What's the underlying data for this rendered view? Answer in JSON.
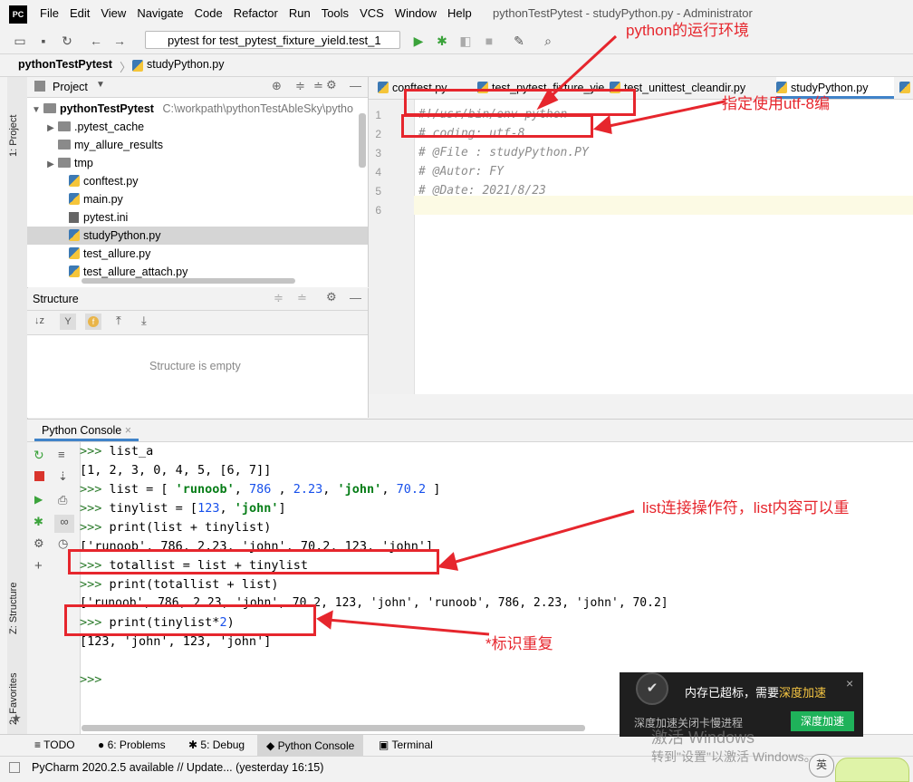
{
  "menubar": {
    "logo": "PC",
    "items": [
      "File",
      "Edit",
      "View",
      "Navigate",
      "Code",
      "Refactor",
      "Run",
      "Tools",
      "VCS",
      "Window",
      "Help"
    ],
    "title": "pythonTestPytest - studyPython.py - Administrator"
  },
  "toolbar": {
    "run_config": "pytest for test_pytest_fixture_yield.test_1"
  },
  "breadcrumb": {
    "project": "pythonTestPytest",
    "file": "studyPython.py"
  },
  "left_strip": {
    "project_tab": "1: Project",
    "structure_tab": "Z: Structure",
    "favorites_tab": "2: Favorites"
  },
  "project": {
    "header": "Project",
    "root_name": "pythonTestPytest",
    "root_path": "C:\\workpath\\pythonTestAbleSky\\pytho",
    "items": [
      {
        "name": ".pytest_cache",
        "kind": "folder",
        "expand": "▶"
      },
      {
        "name": "my_allure_results",
        "kind": "folder",
        "expand": ""
      },
      {
        "name": "tmp",
        "kind": "folder",
        "expand": "▶"
      },
      {
        "name": "conftest.py",
        "kind": "py",
        "expand": ""
      },
      {
        "name": "main.py",
        "kind": "py",
        "expand": ""
      },
      {
        "name": "pytest.ini",
        "kind": "ini",
        "expand": ""
      },
      {
        "name": "studyPython.py",
        "kind": "py",
        "expand": ""
      },
      {
        "name": "test_allure.py",
        "kind": "py",
        "expand": ""
      },
      {
        "name": "test_allure_attach.py",
        "kind": "py",
        "expand": ""
      }
    ]
  },
  "structure": {
    "header": "Structure",
    "empty_text": "Structure is empty"
  },
  "editor": {
    "tabs": [
      "conftest.py",
      "test_pytest_fixture_yield.py",
      "test_unittest_cleandir.py",
      "studyPython.py"
    ],
    "active_tab": 3,
    "lines": [
      {
        "n": "1",
        "text": "#!/usr/bin/env python"
      },
      {
        "n": "2",
        "text": "# coding: utf-8"
      },
      {
        "n": "3",
        "text": "# @File : studyPython.PY"
      },
      {
        "n": "4",
        "text": "# @Autor: FY"
      },
      {
        "n": "5",
        "text": "# @Date: 2021/8/23"
      },
      {
        "n": "6",
        "text": ""
      }
    ]
  },
  "console": {
    "tab": "Python Console",
    "lines": [
      ">>> list_a",
      "[1, 2, 3, 0, 4, 5, [6, 7]]",
      ">>> list = [ 'runoob', 786 , 2.23, 'john', 70.2 ]",
      ">>> tinylist = [123, 'john']",
      ">>> print(list + tinylist)",
      "['runoob', 786, 2.23, 'john', 70.2, 123, 'john']",
      ">>> totallist = list + tinylist",
      ">>> print(totallist + list)",
      "['runoob', 786, 2.23, 'john', 70.2, 123, 'john', 'runoob', 786, 2.23, 'john', 70.2]",
      ">>> print(tinylist*2)",
      "[123, 'john', 123, 'john']",
      "",
      ">>>"
    ]
  },
  "bottom_tabs": [
    "TODO",
    "6: Problems",
    "5: Debug",
    "Python Console",
    "Terminal"
  ],
  "status": "PyCharm 2020.2.5 available // Update... (yesterday 16:15)",
  "annotations": {
    "env": "python的运行环境",
    "utf8": "指定使用utf-8编",
    "concat": "list连接操作符，list内容可以重",
    "repeat": "*标识重复"
  },
  "toast": {
    "message": "内存已超标，需要",
    "highlight": "深度加速",
    "subtext": "深度加速关闭卡慢进程",
    "button": "深度加速"
  },
  "watermark": {
    "line1": "激活 Windows",
    "line2": "转到\"设置\"以激活 Windows。"
  },
  "colors": {
    "annotation": "#e6262d",
    "accent": "#4083c9",
    "toast_button": "#1fb25a"
  }
}
